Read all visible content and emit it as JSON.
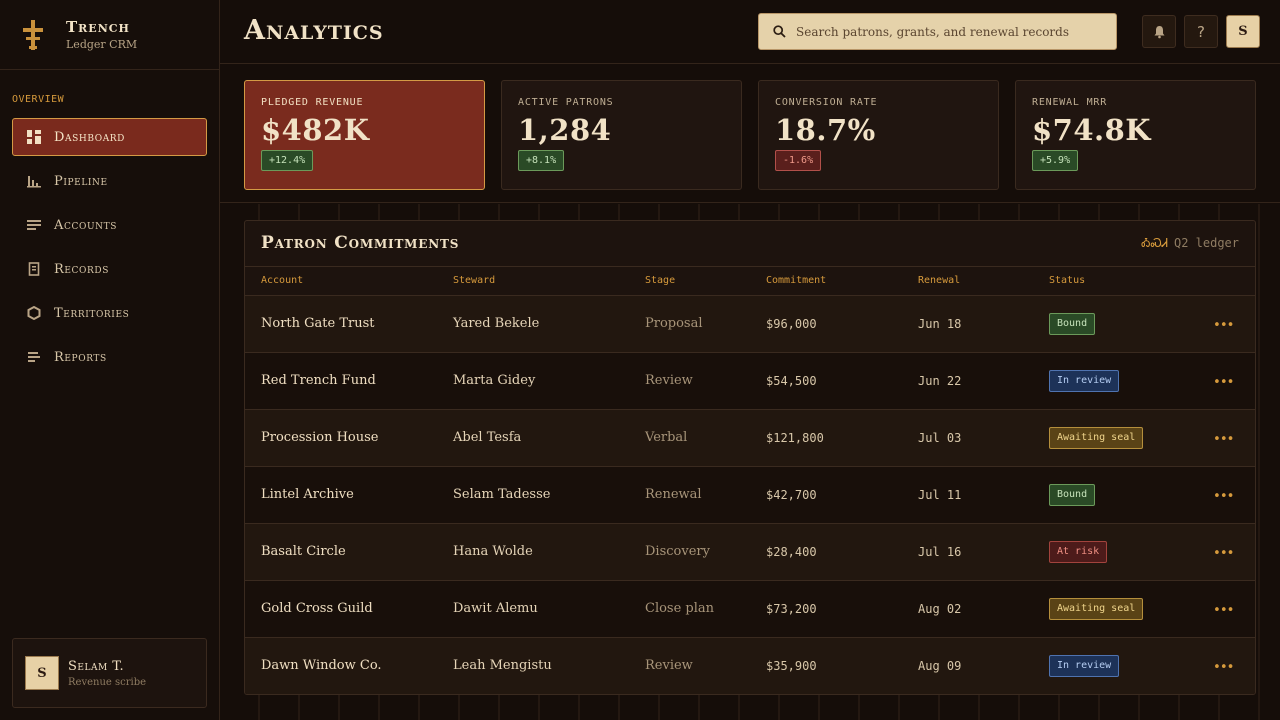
{
  "brand": {
    "title": "Trench",
    "subtitle": "Ledger CRM"
  },
  "sidebar": {
    "section_label": "OVERVIEW",
    "items": [
      {
        "label": "Dashboard",
        "icon": "dashboard-grid-icon",
        "active": true
      },
      {
        "label": "Pipeline",
        "icon": "bar-chart-icon",
        "active": false
      },
      {
        "label": "Accounts",
        "icon": "lines-icon",
        "active": false
      },
      {
        "label": "Records",
        "icon": "document-icon",
        "active": false
      },
      {
        "label": "Territories",
        "icon": "hexagon-icon",
        "active": false
      },
      {
        "label": "Reports",
        "icon": "report-lines-icon",
        "active": false
      }
    ]
  },
  "user": {
    "initial": "S",
    "name": "Selam T.",
    "role": "Revenue scribe"
  },
  "header": {
    "title": "Analytics",
    "search_placeholder": "Search patrons, grants, and renewal records",
    "help_label": "?",
    "user_initial": "S"
  },
  "kpis": [
    {
      "label": "PLEDGED REVENUE",
      "value": "$482K",
      "delta": "+12.4%",
      "trend": "up"
    },
    {
      "label": "ACTIVE PATRONS",
      "value": "1,284",
      "delta": "+8.1%",
      "trend": "up"
    },
    {
      "label": "CONVERSION RATE",
      "value": "18.7%",
      "delta": "-1.6%",
      "trend": "down"
    },
    {
      "label": "RENEWAL MRR",
      "value": "$74.8K",
      "delta": "+5.9%",
      "trend": "up"
    }
  ],
  "table": {
    "title": "Patron Commitments",
    "meta_glyph": "ᎣᏍᏗ",
    "meta": "Q2 ledger",
    "columns": [
      "Account",
      "Steward",
      "Stage",
      "Commitment",
      "Renewal",
      "Status"
    ],
    "rows": [
      {
        "account": "North Gate Trust",
        "steward": "Yared Bekele",
        "stage": "Proposal",
        "commitment": "$96,000",
        "renewal": "Jun 18",
        "status": "Bound"
      },
      {
        "account": "Red Trench Fund",
        "steward": "Marta Gidey",
        "stage": "Review",
        "commitment": "$54,500",
        "renewal": "Jun 22",
        "status": "In review"
      },
      {
        "account": "Procession House",
        "steward": "Abel Tesfa",
        "stage": "Verbal",
        "commitment": "$121,800",
        "renewal": "Jul 03",
        "status": "Awaiting seal"
      },
      {
        "account": "Lintel Archive",
        "steward": "Selam Tadesse",
        "stage": "Renewal",
        "commitment": "$42,700",
        "renewal": "Jul 11",
        "status": "Bound"
      },
      {
        "account": "Basalt Circle",
        "steward": "Hana Wolde",
        "stage": "Discovery",
        "commitment": "$28,400",
        "renewal": "Jul 16",
        "status": "At risk"
      },
      {
        "account": "Gold Cross Guild",
        "steward": "Dawit Alemu",
        "stage": "Close plan",
        "commitment": "$73,200",
        "renewal": "Aug 02",
        "status": "Awaiting seal"
      },
      {
        "account": "Dawn Window Co.",
        "steward": "Leah Mengistu",
        "stage": "Review",
        "commitment": "$35,900",
        "renewal": "Aug 09",
        "status": "In review"
      }
    ],
    "row_menu_label": "•••"
  },
  "colors": {
    "background": "#150d09",
    "accent_gold": "#d69a3c",
    "accent_red": "#7a2b1e",
    "parchment": "#e5d2aa"
  }
}
